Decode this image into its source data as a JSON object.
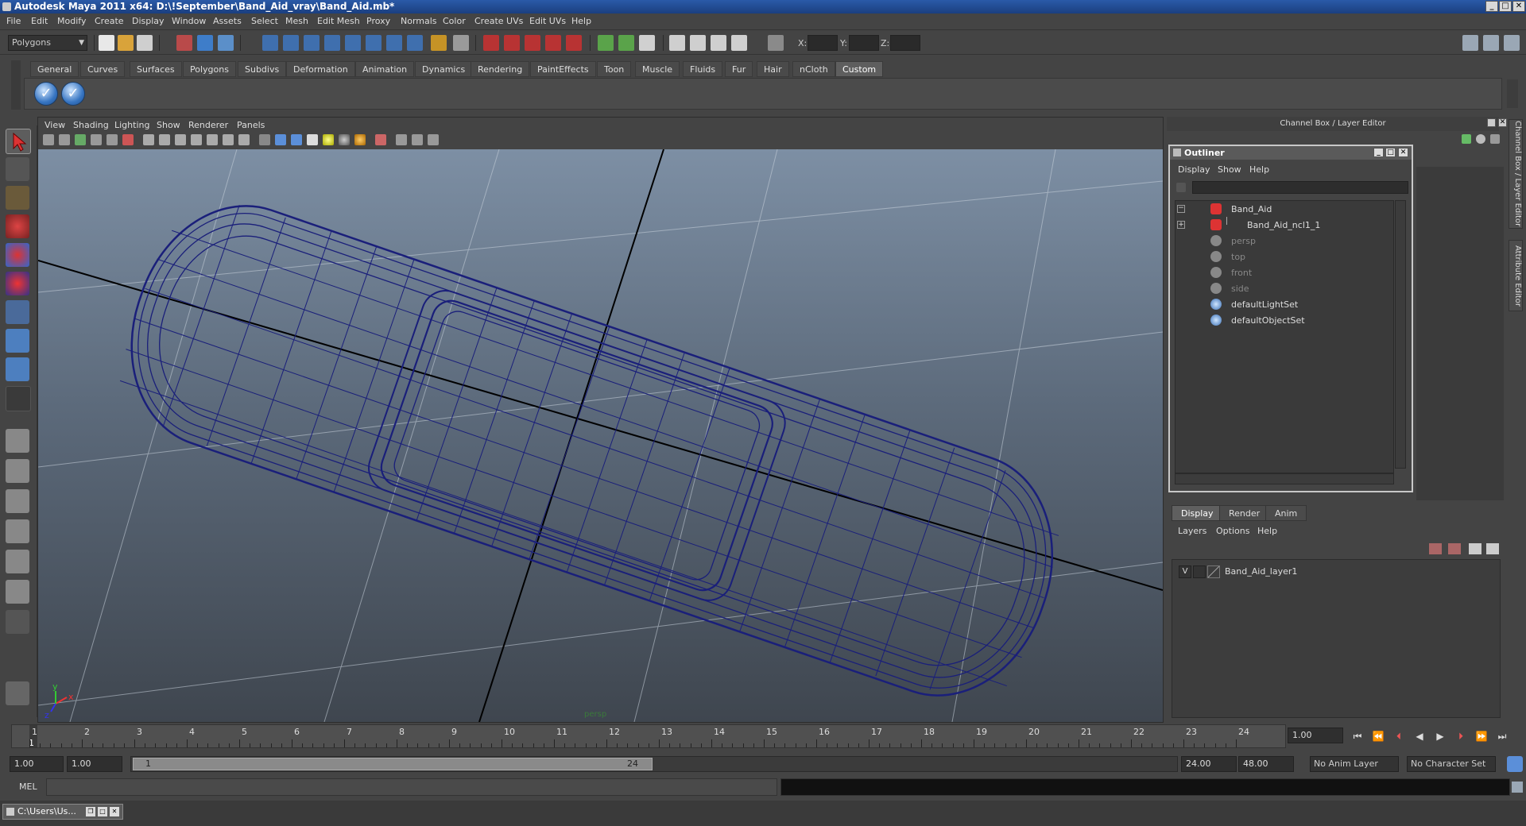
{
  "window": {
    "title": "Autodesk Maya 2011 x64: D:\\!September\\Band_Aid_vray\\Band_Aid.mb*",
    "controls": [
      "_",
      "□",
      "✕"
    ]
  },
  "menu": [
    "File",
    "Edit",
    "Modify",
    "Create",
    "Display",
    "Window",
    "Assets",
    "Select",
    "Mesh",
    "Edit Mesh",
    "Proxy",
    "Normals",
    "Color",
    "Create UVs",
    "Edit UVs",
    "Help"
  ],
  "status_line": {
    "mode": "Polygons",
    "coords": {
      "x_label": "X:",
      "y_label": "Y:",
      "z_label": "Z:"
    }
  },
  "shelf": {
    "tabs": [
      "General",
      "Curves",
      "Surfaces",
      "Polygons",
      "Subdivs",
      "Deformation",
      "Animation",
      "Dynamics",
      "Rendering",
      "PaintEffects",
      "Toon",
      "Muscle",
      "Fluids",
      "Fur",
      "Hair",
      "nCloth",
      "Custom"
    ],
    "active_tab": "Custom"
  },
  "viewport": {
    "menu": [
      "View",
      "Shading",
      "Lighting",
      "Show",
      "Renderer",
      "Panels"
    ],
    "camera_label": "persp",
    "axis": {
      "x": "x",
      "y": "y",
      "z": "z"
    },
    "wire_color": "#1a1f7a"
  },
  "channel_box": {
    "title": "Channel Box / Layer Editor"
  },
  "side_tabs": [
    "Channel Box / Layer Editor",
    "Attribute Editor"
  ],
  "outliner": {
    "title": "Outliner",
    "menu": [
      "Display",
      "Show",
      "Help"
    ],
    "items": [
      {
        "label": "Band_Aid",
        "dim": false,
        "type": "mesh",
        "expand": "−"
      },
      {
        "label": "Band_Aid_ncl1_1",
        "dim": false,
        "type": "mesh",
        "expand": "+"
      },
      {
        "label": "persp",
        "dim": true,
        "type": "camera",
        "expand": ""
      },
      {
        "label": "top",
        "dim": true,
        "type": "camera",
        "expand": ""
      },
      {
        "label": "front",
        "dim": true,
        "type": "camera",
        "expand": ""
      },
      {
        "label": "side",
        "dim": true,
        "type": "camera",
        "expand": ""
      },
      {
        "label": "defaultLightSet",
        "dim": false,
        "type": "set",
        "expand": ""
      },
      {
        "label": "defaultObjectSet",
        "dim": false,
        "type": "set",
        "expand": ""
      }
    ]
  },
  "layer_editor": {
    "tabs": [
      "Display",
      "Render",
      "Anim"
    ],
    "active_tab": "Display",
    "menu": [
      "Layers",
      "Options",
      "Help"
    ],
    "layers": [
      {
        "visible": "V",
        "name": "Band_Aid_layer1"
      }
    ]
  },
  "time_slider": {
    "ticks": [
      "1",
      "2",
      "3",
      "4",
      "5",
      "6",
      "7",
      "8",
      "9",
      "10",
      "11",
      "12",
      "13",
      "14",
      "15",
      "16",
      "17",
      "18",
      "19",
      "20",
      "21",
      "22",
      "23",
      "24"
    ],
    "current_frame": "1",
    "current_time_field": "1.00"
  },
  "range_slider": {
    "start_time": "1.00",
    "playback_start": "1.00",
    "range_start_label": "1",
    "range_end_label": "24",
    "playback_end": "24.00",
    "end_time": "48.00",
    "anim_layer": "No Anim Layer",
    "character_set": "No Character Set"
  },
  "command_line": {
    "label": "MEL"
  },
  "minimized_window": {
    "label": "C:\\Users\\Us..."
  }
}
